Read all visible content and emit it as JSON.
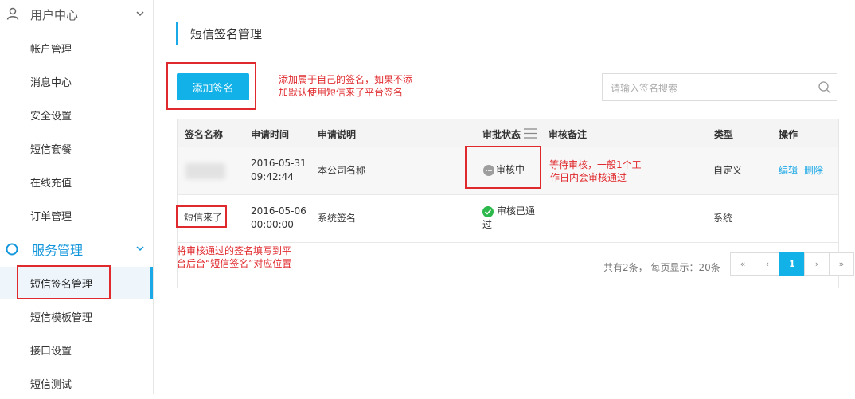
{
  "sidebar": {
    "group_user": "用户中心",
    "user_items": [
      "帐户管理",
      "消息中心",
      "安全设置",
      "短信套餐",
      "在线充值",
      "订单管理"
    ],
    "group_service": "服务管理",
    "service_items": [
      "短信签名管理",
      "短信模板管理",
      "接口设置",
      "短信测试"
    ],
    "active_item": "短信签名管理"
  },
  "page": {
    "title": "短信签名管理",
    "add_button": "添加签名",
    "search_placeholder": "请输入签名搜索"
  },
  "annotations": {
    "add_note_line1": "添加属于自己的签名，如果不添",
    "add_note_line2": "加默认使用短信来了平台签名",
    "review_note_line1": "等待审核，一般1个工",
    "review_note_line2": "作日内会审核通过",
    "sidebar_note_line1": "将审核通过的签名填写到平",
    "sidebar_note_line2": "台后台“短信签名”对应位置"
  },
  "table": {
    "headers": [
      "签名名称",
      "申请时间",
      "申请说明",
      "审批状态",
      "审核备注",
      "类型",
      "操作"
    ],
    "rows": [
      {
        "date": "2016-05-31",
        "time": "09:42:44",
        "desc": "本公司名称",
        "status": "审核中",
        "type": "自定义",
        "edit": "编辑",
        "delete": "删除"
      },
      {
        "name": "短信来了",
        "date": "2016-05-06",
        "time": "00:00:00",
        "desc": "系统签名",
        "status_line1": "审核已通",
        "status_line2": "过",
        "type": "系统"
      }
    ]
  },
  "pagination": {
    "info": "共有2条， 每页显示：20条",
    "first": "«",
    "prev": "‹",
    "current": "1",
    "next": "›",
    "last": "»"
  },
  "colors": {
    "accent": "#12b2e8",
    "annotation_red": "#e0292d",
    "success_green": "#2db84b"
  }
}
